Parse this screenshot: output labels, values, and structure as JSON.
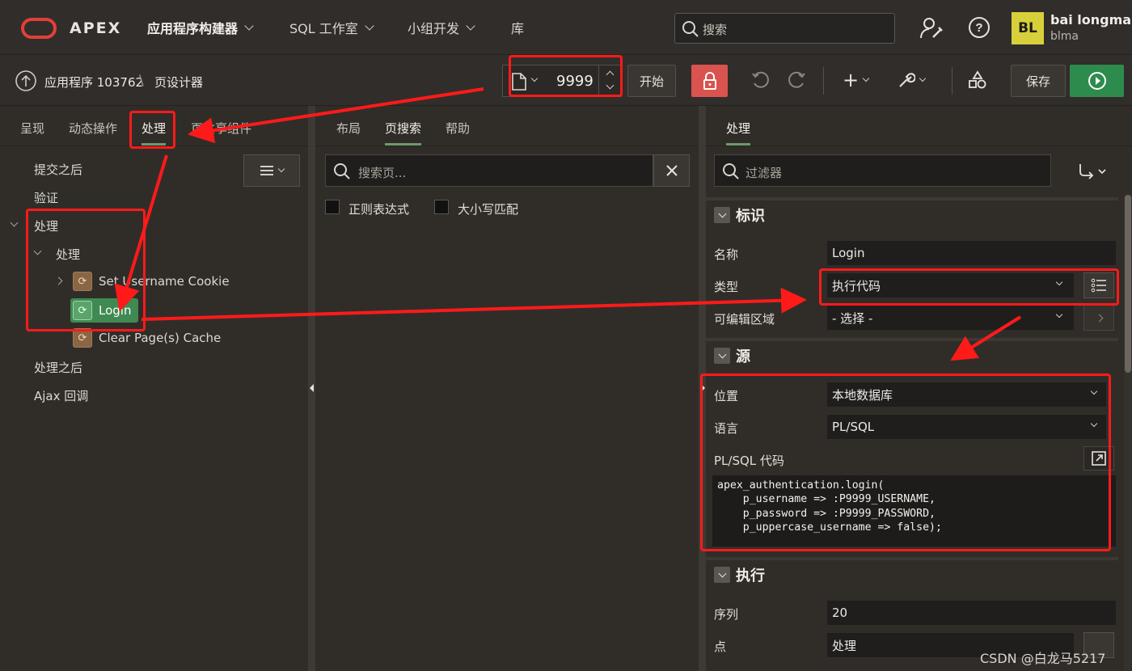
{
  "app": {
    "logo_text": "APEX",
    "nav": [
      {
        "label": "应用程序构建器"
      },
      {
        "label": "SQL 工作室"
      },
      {
        "label": "小组开发"
      },
      {
        "label": "库"
      }
    ],
    "search_placeholder": "搜索",
    "user": {
      "initials": "BL",
      "name": "bai longma",
      "workspace": "blma"
    }
  },
  "toolbar": {
    "breadcrumb_app": "应用程序 103762",
    "breadcrumb_sep": "\\",
    "breadcrumb_page": "页设计器",
    "page_number": "9999",
    "go_label": "开始",
    "save_label": "保存"
  },
  "left_panel": {
    "tabs": [
      "呈现",
      "动态操作",
      "处理",
      "页共享组件"
    ],
    "active_tab": "处理",
    "tree": {
      "after_submit": "提交之后",
      "validation": "验证",
      "processing": "处理",
      "processing_sub": "处理",
      "items": [
        "Set Username Cookie",
        "Login",
        "Clear Page(s) Cache"
      ],
      "after_processing": "处理之后",
      "ajax_callback": "Ajax 回调"
    }
  },
  "middle_panel": {
    "tabs": [
      "布局",
      "页搜索",
      "帮助"
    ],
    "active_tab": "页搜索",
    "search_placeholder": "搜索页...",
    "regex_label": "正则表达式",
    "case_label": "大小写匹配"
  },
  "right_panel": {
    "tab": "处理",
    "filter_placeholder": "过滤器",
    "sections": {
      "identification": {
        "title": "标识",
        "name_label": "名称",
        "name_value": "Login",
        "type_label": "类型",
        "type_value": "执行代码",
        "editable_region_label": "可编辑区域",
        "editable_region_value": "- 选择 -"
      },
      "source": {
        "title": "源",
        "location_label": "位置",
        "location_value": "本地数据库",
        "language_label": "语言",
        "language_value": "PL/SQL",
        "code_label": "PL/SQL 代码",
        "code_lines": [
          "apex_authentication.login(",
          "    p_username => :P9999_USERNAME,",
          "    p_password => :P9999_PASSWORD,",
          "    p_uppercase_username => false);"
        ]
      },
      "execution": {
        "title": "执行",
        "sequence_label": "序列",
        "sequence_value": "20",
        "point_label": "点",
        "point_value": "处理"
      }
    }
  },
  "watermark": "CSDN @白龙马5217",
  "colors": {
    "accent_green": "#2e8b4e",
    "annotation_red": "#ff1a1a",
    "lock_red": "#d9534f"
  }
}
